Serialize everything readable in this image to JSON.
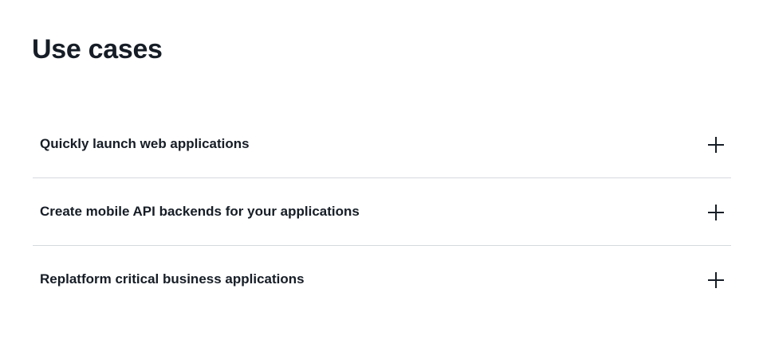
{
  "section": {
    "title": "Use cases"
  },
  "accordion": {
    "items": [
      {
        "label": "Quickly launch web applications",
        "icon": "plus-icon"
      },
      {
        "label": "Create mobile API backends for your applications",
        "icon": "plus-icon"
      },
      {
        "label": "Replatform critical business applications",
        "icon": "plus-icon"
      }
    ]
  },
  "colors": {
    "text": "#161d26",
    "divider": "#d5d9dd",
    "background": "#ffffff"
  }
}
